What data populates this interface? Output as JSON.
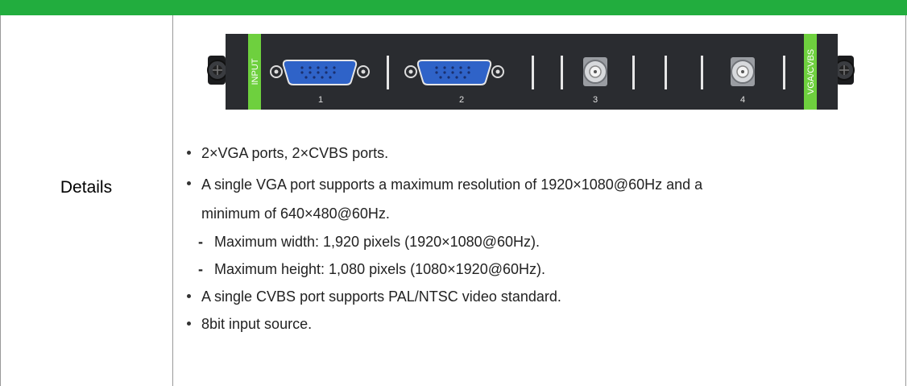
{
  "table": {
    "row_label": "Details"
  },
  "panel": {
    "left_tag": "INPUT",
    "right_tag": "VGA/CVBS",
    "port_numbers": [
      "1",
      "2",
      "3",
      "4"
    ]
  },
  "details": {
    "bullet_1": "2×VGA ports, 2×CVBS ports.",
    "bullet_2_line1": "A single VGA port supports a maximum resolution of 1920×1080@60Hz and a",
    "bullet_2_line2": "minimum of 640×480@60Hz.",
    "sub_1": "Maximum width: 1,920 pixels (1920×1080@60Hz).",
    "sub_2": "Maximum height: 1,080 pixels (1080×1920@60Hz).",
    "bullet_3": "A single CVBS port supports PAL/NTSC video standard.",
    "bullet_4": "8bit input source."
  },
  "colors": {
    "header": "#22ad3e",
    "panel_body": "#2a2c30",
    "tag_green": "#6ed03e",
    "vga_blue": "#2f63c8"
  }
}
